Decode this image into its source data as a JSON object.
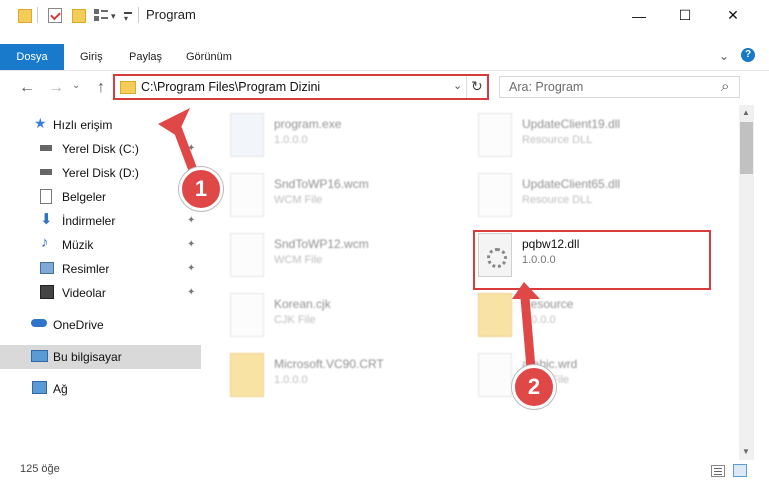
{
  "window": {
    "title": "Program",
    "minimize": "—",
    "maximize": "☐",
    "close": "✕"
  },
  "ribbon": {
    "tabs": [
      "Dosya",
      "Giriş",
      "Paylaş",
      "Görünüm"
    ],
    "expand": "⌄",
    "help": "?"
  },
  "nav": {
    "back": "←",
    "forward": "→",
    "up_dropdown": "⌄",
    "up": "↑",
    "address": "C:\\Program Files\\Program Dizini",
    "address_dropdown": "⌄",
    "refresh": "↻",
    "search_placeholder": "Ara: Program",
    "search_icon": "⌕"
  },
  "sidebar": {
    "items": [
      {
        "label": "Hızlı erişim",
        "icon": "star-icon",
        "pinned": false
      },
      {
        "label": "Yerel Disk (C:)",
        "icon": "drive-icon",
        "pinned": true
      },
      {
        "label": "Yerel Disk (D:)",
        "icon": "drive-icon",
        "pinned": false
      },
      {
        "label": "Belgeler",
        "icon": "documents-icon",
        "pinned": true
      },
      {
        "label": "İndirmeler",
        "icon": "downloads-icon",
        "pinned": true
      },
      {
        "label": "Müzik",
        "icon": "music-icon",
        "pinned": true
      },
      {
        "label": "Resimler",
        "icon": "pictures-icon",
        "pinned": true
      },
      {
        "label": "Videolar",
        "icon": "videos-icon",
        "pinned": true
      },
      {
        "label": "OneDrive",
        "icon": "cloud-icon",
        "pinned": false
      },
      {
        "label": "Bu bilgisayar",
        "icon": "computer-icon",
        "pinned": false,
        "selected": true
      },
      {
        "label": "Ağ",
        "icon": "network-icon",
        "pinned": false
      }
    ],
    "pin_glyph": "📌"
  },
  "files": [
    {
      "name": "program.exe",
      "type": "1.0.0.0",
      "icon": "exe-icon"
    },
    {
      "name": "UpdateClient19.dll",
      "type": "Resource DLL",
      "icon": "dll-icon"
    },
    {
      "name": "SndToWP16.wcm",
      "type": "WCM File",
      "icon": "file-icon"
    },
    {
      "name": "UpdateClient65.dll",
      "type": "Resource DLL",
      "icon": "dll-icon"
    },
    {
      "name": "SndToWP12.wcm",
      "type": "WCM File",
      "icon": "file-icon"
    },
    {
      "name": "pqbw12.dll",
      "type": "1.0.0.0",
      "icon": "dll-icon",
      "highlighted": true
    },
    {
      "name": "Korean.cjk",
      "type": "CJK File",
      "icon": "file-icon"
    },
    {
      "name": "Resource",
      "type": "1.0.0.0",
      "icon": "folder-icon"
    },
    {
      "name": "Microsoft.VC90.CRT",
      "type": "1.0.0.0",
      "icon": "folder-icon"
    },
    {
      "name": "arabic.wrd",
      "type": "WRD File",
      "icon": "file-icon"
    }
  ],
  "status": {
    "count": "125 öğe"
  },
  "callouts": [
    "1",
    "2"
  ],
  "colors": {
    "accent": "#1979ca",
    "highlight": "#d93a3a",
    "callout": "#e04848"
  }
}
